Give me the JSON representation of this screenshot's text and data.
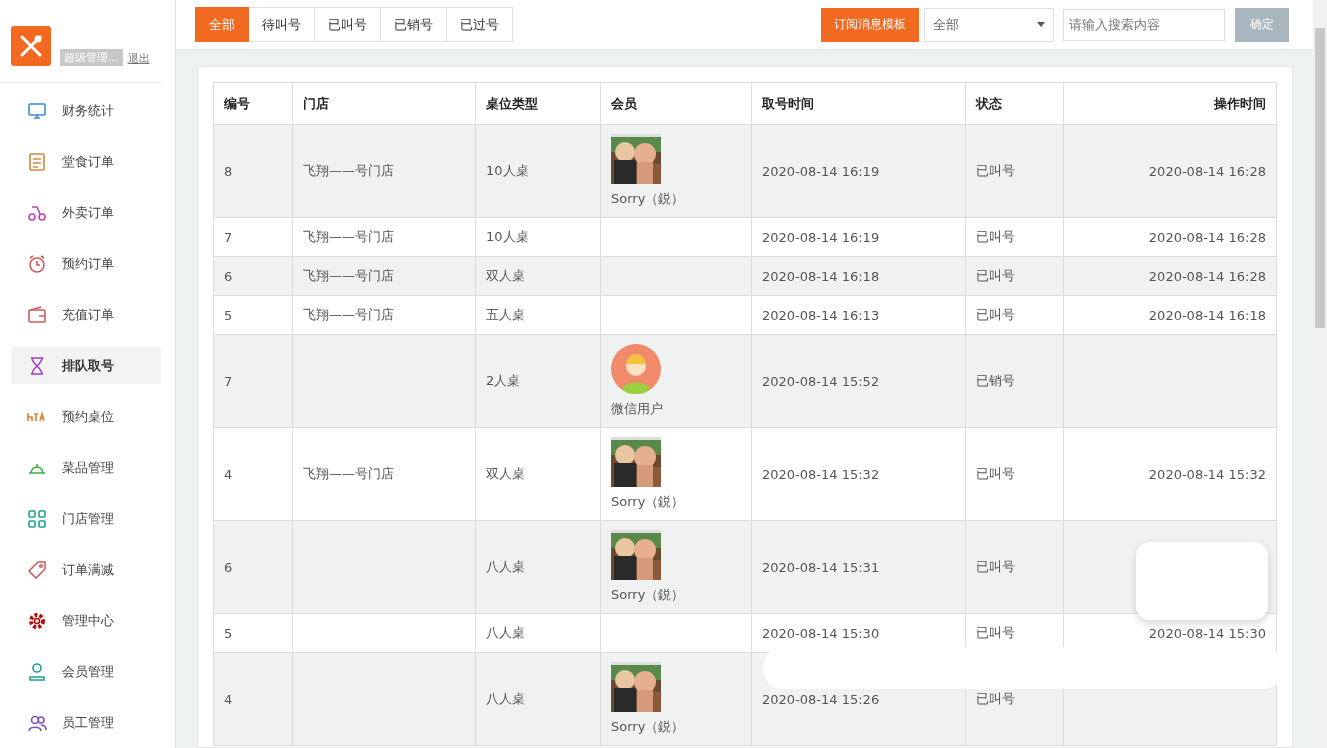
{
  "sidebar": {
    "user": "超级管理...",
    "logout": "退出",
    "items": [
      {
        "label": "财务统计",
        "selected": false
      },
      {
        "label": "堂食订单",
        "selected": false
      },
      {
        "label": "外卖订单",
        "selected": false
      },
      {
        "label": "预约订单",
        "selected": false
      },
      {
        "label": "充值订单",
        "selected": false
      },
      {
        "label": "排队取号",
        "selected": true
      },
      {
        "label": "预约桌位",
        "selected": false
      },
      {
        "label": "菜品管理",
        "selected": false
      },
      {
        "label": "门店管理",
        "selected": false
      },
      {
        "label": "订单满减",
        "selected": false
      },
      {
        "label": "管理中心",
        "selected": false
      },
      {
        "label": "会员管理",
        "selected": false
      },
      {
        "label": "员工管理",
        "selected": false
      }
    ]
  },
  "tabs": [
    {
      "label": "全部",
      "selected": true
    },
    {
      "label": "待叫号",
      "selected": false
    },
    {
      "label": "已叫号",
      "selected": false
    },
    {
      "label": "已销号",
      "selected": false
    },
    {
      "label": "已过号",
      "selected": false
    }
  ],
  "toolbar": {
    "template_button": "订阅消息模板",
    "filter": "全部",
    "search": {
      "placeholder": "请输入搜索内容"
    },
    "confirm_button": "确定"
  },
  "table": {
    "columns": [
      "编号",
      "门店",
      "桌位类型",
      "会员",
      "取号时间",
      "状态",
      "操作时间"
    ],
    "rows": [
      {
        "number": "8",
        "store": "飞翔——号门店",
        "table_type": "10人桌",
        "member": {
          "name": "Sorry（鋭）"
        },
        "taken_at": "2020-08-14 16:19",
        "status": "已叫号",
        "operated_at": "2020-08-14 16:28"
      },
      {
        "number": "7",
        "store": "飞翔——号门店",
        "table_type": "10人桌",
        "taken_at": "2020-08-14 16:19",
        "status": "已叫号",
        "operated_at": "2020-08-14 16:28"
      },
      {
        "number": "6",
        "store": "飞翔——号门店",
        "table_type": "双人桌",
        "taken_at": "2020-08-14 16:18",
        "status": "已叫号",
        "operated_at": "2020-08-14 16:28"
      },
      {
        "number": "5",
        "store": "飞翔——号门店",
        "table_type": "五人桌",
        "taken_at": "2020-08-14 16:13",
        "status": "已叫号",
        "operated_at": "2020-08-14 16:18"
      },
      {
        "number": "7",
        "table_type": "2人桌",
        "member": {
          "kind": "cartoon",
          "name": "微信用户"
        },
        "taken_at": "2020-08-14 15:52",
        "status": "已销号"
      },
      {
        "number": "4",
        "store": "飞翔——号门店",
        "table_type": "双人桌",
        "member": {
          "name": "Sorry（鋭）"
        },
        "taken_at": "2020-08-14 15:32",
        "status": "已叫号",
        "operated_at": "2020-08-14 15:32"
      },
      {
        "number": "6",
        "table_type": "八人桌",
        "member": {
          "name": "Sorry（鋭）"
        },
        "taken_at": "2020-08-14 15:31",
        "status": "已叫号"
      },
      {
        "number": "5",
        "table_type": "八人桌",
        "taken_at": "2020-08-14 15:30",
        "status": "已叫号",
        "operated_at": "2020-08-14 15:30"
      },
      {
        "number": "4",
        "table_type": "八人桌",
        "member": {
          "name": "Sorry（鋭）"
        },
        "taken_at": "2020-08-14 15:26",
        "status": "已叫号"
      }
    ]
  }
}
